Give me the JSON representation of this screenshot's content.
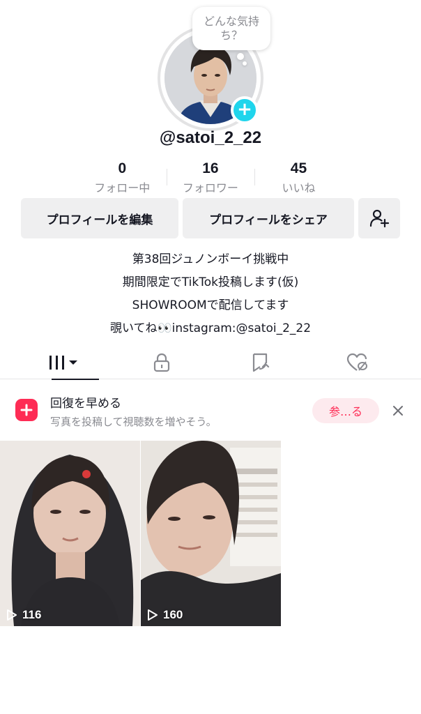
{
  "profile": {
    "mood_prompt": "どんな気持ち？",
    "username": "@satoi_2_22"
  },
  "stats": [
    {
      "value": "0",
      "label": "フォロー中"
    },
    {
      "value": "16",
      "label": "フォロワー"
    },
    {
      "value": "45",
      "label": "いいね"
    }
  ],
  "actions": {
    "edit_profile": "プロフィールを編集",
    "share_profile": "プロフィールをシェア",
    "add_friend_icon": "person-add-icon"
  },
  "bio": [
    "第38回ジュノンボーイ挑戦中",
    "期間限定でTikTok投稿します(仮)",
    "SHOWROOMで配信してます",
    "覗いてね👀instagram:@satoi_2_22"
  ],
  "tabs": [
    {
      "icon": "videos-grid-icon",
      "active": true
    },
    {
      "icon": "lock-icon",
      "active": false
    },
    {
      "icon": "reposts-icon",
      "active": false
    },
    {
      "icon": "liked-icon",
      "active": false
    }
  ],
  "banner": {
    "title": "回復を早める",
    "subtitle": "写真を投稿して視聴数を増やそう。",
    "button": "参…る",
    "accent_color": "#fe2c55"
  },
  "videos": [
    {
      "views": "116"
    },
    {
      "views": "160"
    }
  ],
  "colors": {
    "badge": "#20d5ec",
    "accent": "#fe2c55",
    "text_primary": "#161823",
    "text_secondary": "#8a8b91"
  }
}
